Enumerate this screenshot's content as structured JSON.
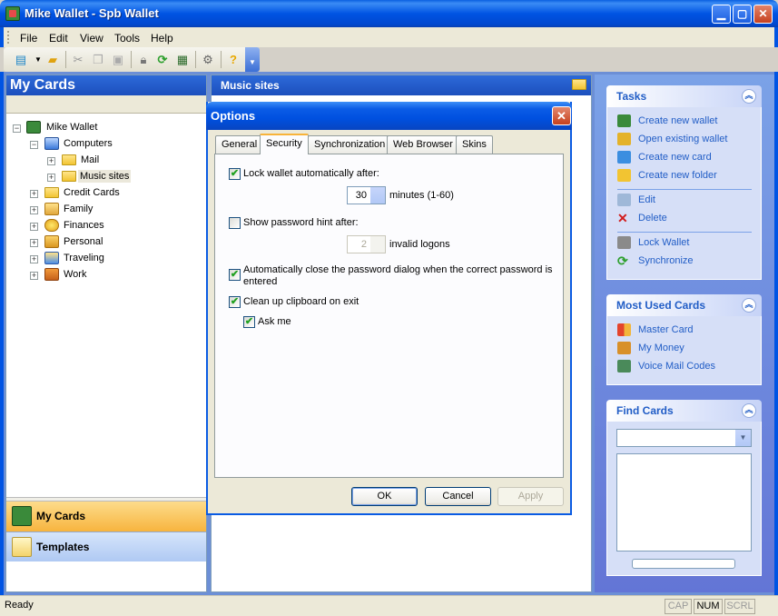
{
  "window": {
    "title": "Mike Wallet - Spb Wallet"
  },
  "menu": {
    "items": [
      "File",
      "Edit",
      "View",
      "Tools",
      "Help"
    ]
  },
  "left_panel": {
    "title": "My Cards",
    "tree": {
      "root": "Mike Wallet",
      "computers": "Computers",
      "mail": "Mail",
      "music": "Music sites",
      "credit": "Credit Cards",
      "family": "Family",
      "finances": "Finances",
      "personal": "Personal",
      "traveling": "Traveling",
      "work": "Work"
    },
    "nav": {
      "my_cards": "My Cards",
      "templates": "Templates",
      "more": "»"
    }
  },
  "center": {
    "title": "Music sites"
  },
  "tasks": {
    "title": "Tasks",
    "items": [
      "Create new wallet",
      "Open existing wallet",
      "Create new card",
      "Create new folder",
      "Edit",
      "Delete",
      "Lock Wallet",
      "Synchronize"
    ]
  },
  "most_used": {
    "title": "Most Used Cards",
    "items": [
      "Master Card",
      "My Money",
      "Voice Mail Codes"
    ]
  },
  "find_cards": {
    "title": "Find Cards",
    "select_value": ""
  },
  "status": {
    "text": "Ready",
    "cap": "CAP",
    "num": "NUM",
    "scrl": "SCRL"
  },
  "dialog": {
    "title": "Options",
    "tabs": [
      "General",
      "Security",
      "Synchronization",
      "Web Browser",
      "Skins"
    ],
    "active_tab": "Security",
    "lock_auto": {
      "label": "Lock wallet automatically after:",
      "checked": true,
      "value": "30",
      "unit": "minutes (1-60)"
    },
    "hint": {
      "label": "Show password hint after:",
      "checked": false,
      "value": "2",
      "unit": "invalid logons"
    },
    "autoclose": {
      "label": "Automatically close the password dialog when the correct password is entered",
      "checked": true
    },
    "clipboard": {
      "label": "Clean up clipboard on exit",
      "checked": true
    },
    "ask": {
      "label": "Ask me",
      "checked": true
    },
    "buttons": {
      "ok": "OK",
      "cancel": "Cancel",
      "apply": "Apply"
    }
  },
  "colors": {
    "title_bar": "#0054e3",
    "task_link": "#215dc6",
    "task_bg": "#6375d6",
    "nav_active": "#f7b43e"
  },
  "check_glyph": "✔"
}
